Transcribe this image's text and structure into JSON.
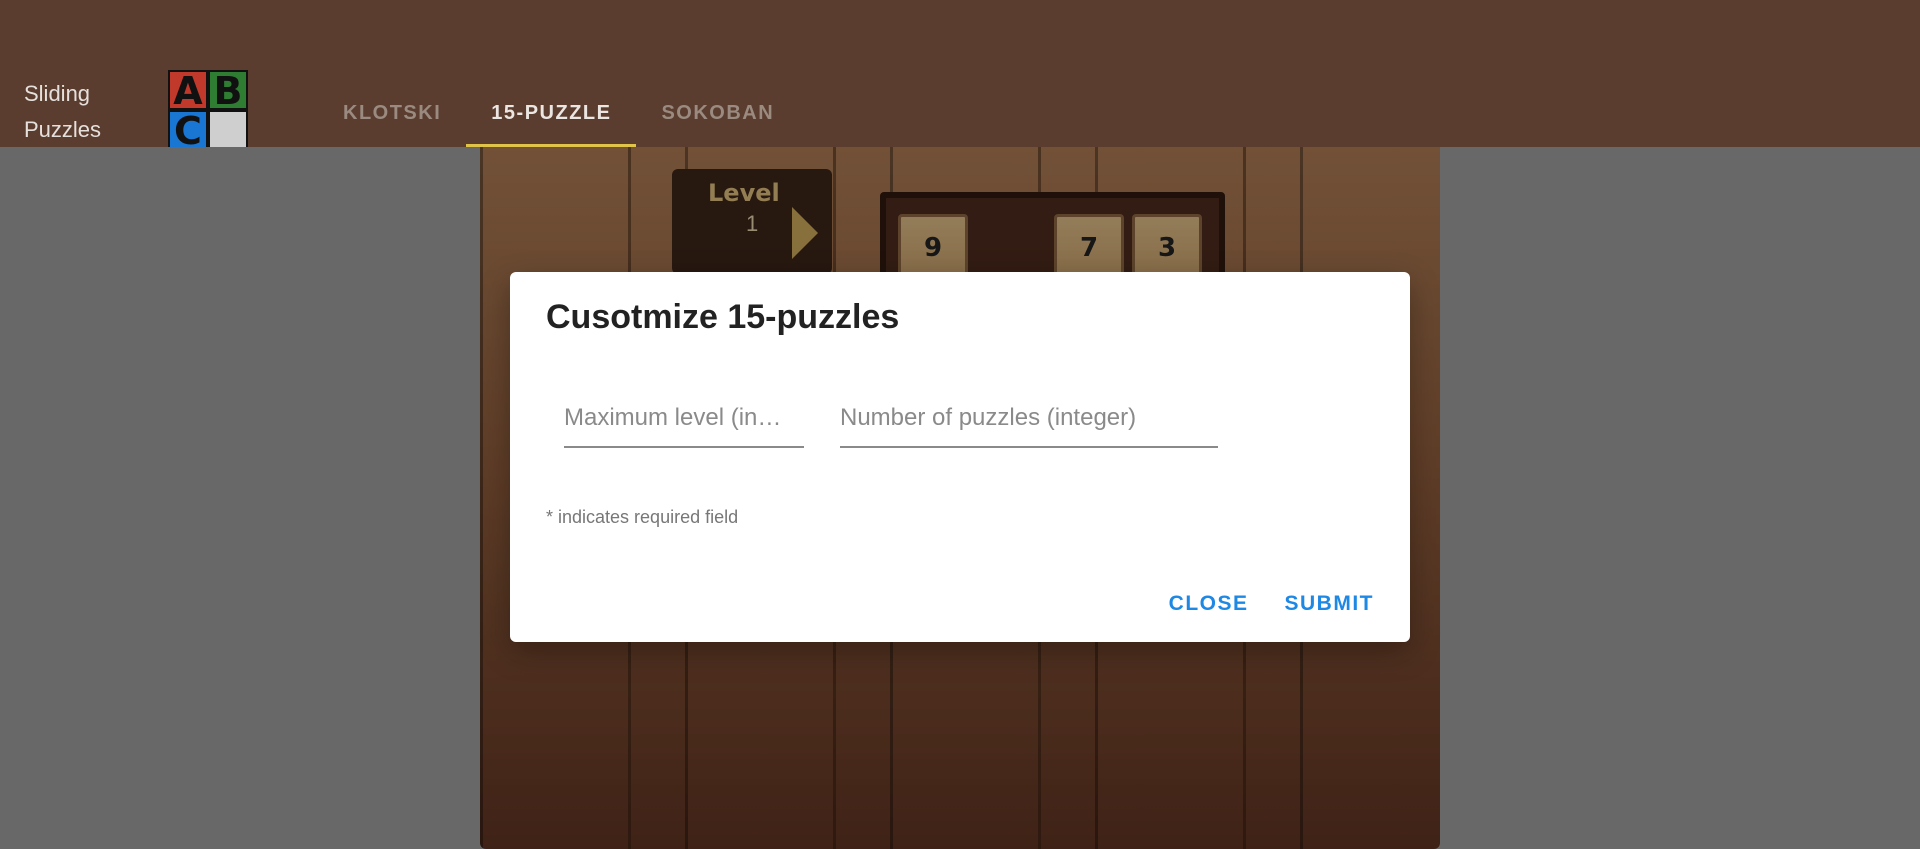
{
  "app": {
    "brand_line1": "Sliding",
    "brand_line2": "Puzzles",
    "logo_letters": [
      "A",
      "B",
      "C",
      ""
    ],
    "logo_colors": [
      "#c0392b",
      "#2e7d32",
      "#1976d2",
      "#cfcfcf"
    ]
  },
  "nav": {
    "tabs": [
      {
        "label": "KLOTSKI",
        "active": false
      },
      {
        "label": "15-PUZZLE",
        "active": true
      },
      {
        "label": "SOKOBAN",
        "active": false
      }
    ]
  },
  "game": {
    "level_title": "Level",
    "level_value": "1",
    "tiles": [
      "9",
      "7",
      "3"
    ]
  },
  "dialog": {
    "title": "Cusotmize 15-puzzles",
    "max_level_placeholder": "Maximum level (in…",
    "num_puzzles_placeholder": "Number of puzzles (integer)",
    "required_hint": "* indicates required field",
    "close_label": "CLOSE",
    "submit_label": "SUBMIT"
  },
  "colors": {
    "header_bg": "#5a3d2f",
    "accent": "#1e88e5",
    "tab_indicator": "#e0c44a"
  }
}
